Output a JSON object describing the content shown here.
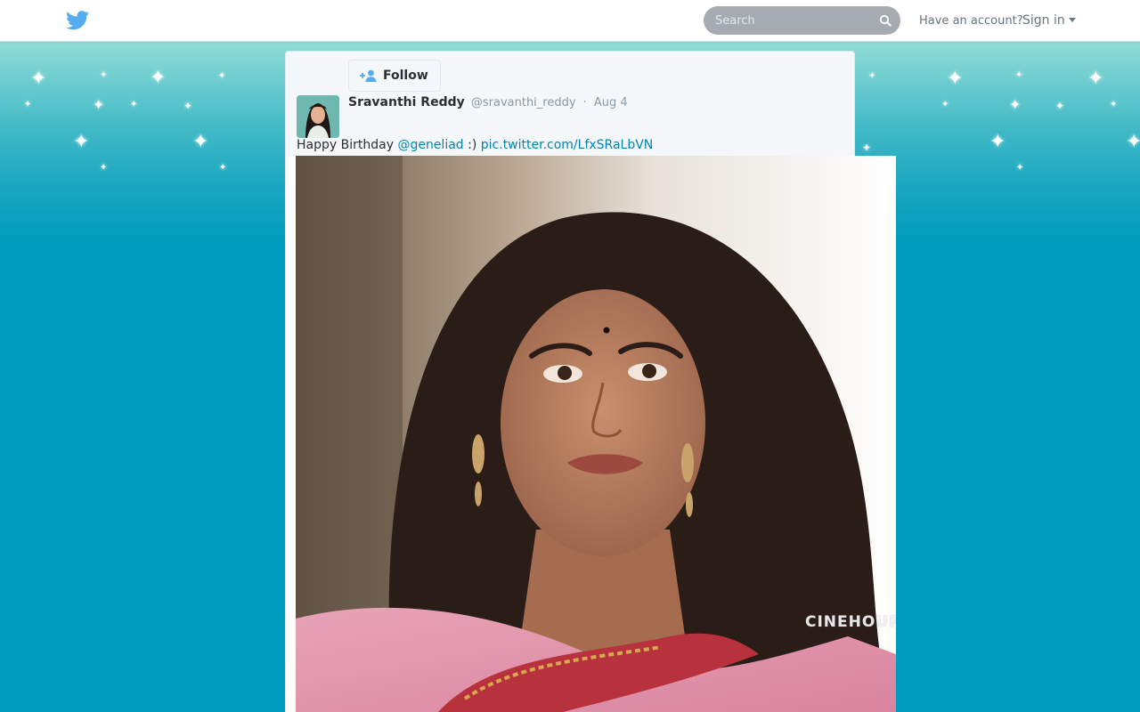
{
  "topbar": {
    "logo_icon": "twitter-bird-icon",
    "search": {
      "placeholder": "Search",
      "icon": "search-icon"
    },
    "have_account_label": "Have an account?",
    "signin_label": "Sign in"
  },
  "tweet": {
    "follow_label": "Follow",
    "follow_icon": "add-user-icon",
    "fullname": "Sravanthi Reddy",
    "username": "@sravanthi_reddy",
    "separator": "·",
    "date": "Aug 4",
    "text_prefix": "Happy Birthday",
    "mention": "@geneliad",
    "text_suffix": ":)",
    "link": "pic.twitter.com/LfxSRaLbVN",
    "photo_watermark": "CINEHOUR"
  },
  "colors": {
    "brand": "#55acee",
    "link": "#0084b4",
    "background": "#009cbd"
  }
}
